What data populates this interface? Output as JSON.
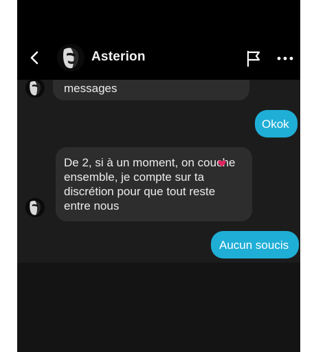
{
  "header": {
    "contact_name": "Asterion",
    "icons": [
      "chevron-left-icon",
      "avatar",
      "flag-icon",
      "more-icon"
    ]
  },
  "messages": [
    {
      "direction": "incoming",
      "text": "messages"
    },
    {
      "direction": "outgoing",
      "text": "Okok"
    },
    {
      "direction": "incoming",
      "text": "De 2, si à un moment, on couche\nensemble, je compte sur ta\ndiscrétion pour que tout reste\nentre nous"
    },
    {
      "direction": "outgoing",
      "text": "Aucun soucis"
    }
  ],
  "colors": {
    "outgoing_bubble": "#1faed6",
    "incoming_bubble": "#2d2d2d",
    "background": "#1c1c1c",
    "header": "#000000",
    "heart": "#e0245e"
  }
}
